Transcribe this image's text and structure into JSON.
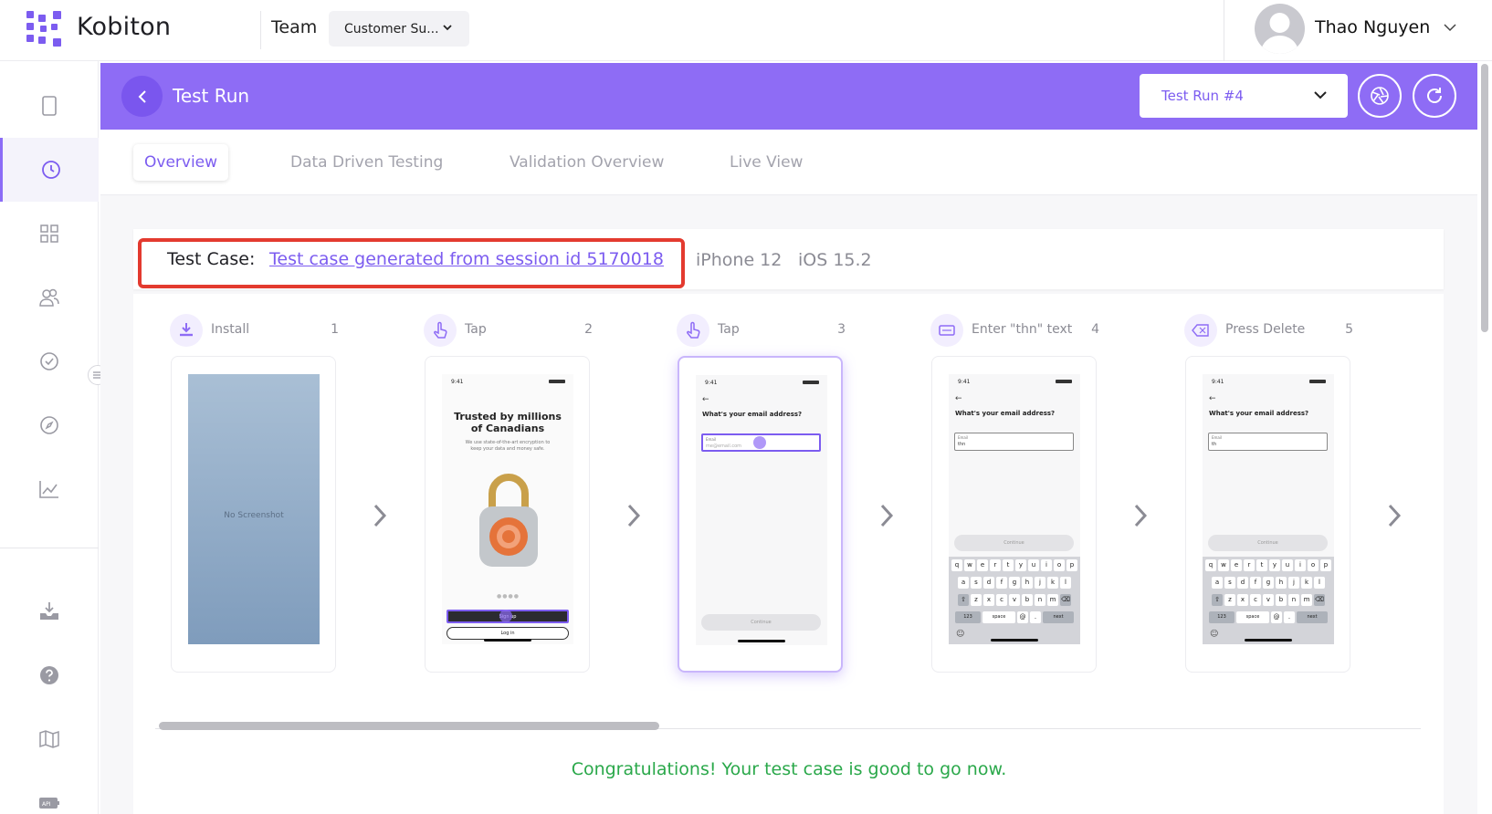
{
  "brand": {
    "name": "Kobiton",
    "accent": "#8e6cf5"
  },
  "topbar": {
    "team_label": "Team",
    "team_value": "Customer Su...",
    "user_name": "Thao Nguyen"
  },
  "sidebar": {
    "items": [
      {
        "name": "device-icon"
      },
      {
        "name": "clock-icon",
        "active": true
      },
      {
        "name": "grid-icon"
      },
      {
        "name": "users-icon"
      },
      {
        "name": "check-circle-icon"
      },
      {
        "name": "compass-icon"
      },
      {
        "name": "chart-icon"
      },
      {
        "name": "download-icon"
      },
      {
        "name": "help-icon"
      },
      {
        "name": "map-icon"
      },
      {
        "name": "api-icon"
      }
    ]
  },
  "header": {
    "title": "Test Run",
    "run_select": "Test Run #4"
  },
  "tabs": [
    {
      "label": "Overview",
      "active": true
    },
    {
      "label": "Data Driven Testing"
    },
    {
      "label": "Validation Overview"
    },
    {
      "label": "Live View"
    }
  ],
  "test_case": {
    "label": "Test Case:",
    "link": "Test case generated from session id 5170018",
    "device": "iPhone 12",
    "os": "iOS 15.2"
  },
  "steps": [
    {
      "label": "Install",
      "num": "1",
      "icon": "download-icon"
    },
    {
      "label": "Tap",
      "num": "2",
      "icon": "tap-icon"
    },
    {
      "label": "Tap",
      "num": "3",
      "icon": "tap-icon"
    },
    {
      "label": "Enter \"thn\" text",
      "num": "4",
      "icon": "keyboard-icon"
    },
    {
      "label": "Press Delete",
      "num": "5",
      "icon": "delete-key-icon"
    }
  ],
  "screens": {
    "no_screenshot": "No Screenshot",
    "time": "9:41",
    "headline": "Trusted by millions of Canadians",
    "subtext": "We use state-of-the-art encryption to keep your data and money safe.",
    "signup": "Sign up",
    "login": "Log in",
    "question": "What's your email address?",
    "email_label": "Email",
    "email_placeholder": "me@email.com",
    "email_typed": "thn",
    "email_deleted": "th",
    "continue": "Continue",
    "kb_row1": [
      "q",
      "w",
      "e",
      "r",
      "t",
      "y",
      "u",
      "i",
      "o",
      "p"
    ],
    "kb_row2": [
      "a",
      "s",
      "d",
      "f",
      "g",
      "h",
      "j",
      "k",
      "l"
    ],
    "kb_row3": [
      "z",
      "x",
      "c",
      "v",
      "b",
      "n",
      "m"
    ],
    "kb_123": "123",
    "kb_space": "space",
    "kb_at": "@",
    "kb_dot": ".",
    "kb_next": "next"
  },
  "congrats": "Congratulations! Your test case is good to go now."
}
